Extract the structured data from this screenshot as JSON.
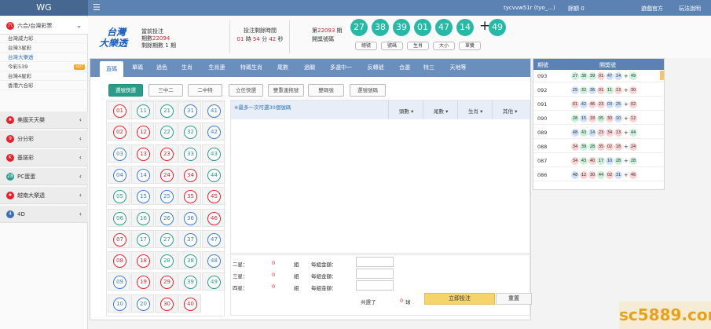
{
  "topbar": {
    "brand": "WG",
    "menu_icon": "hamburger-icon",
    "user": "tycvvw51r (tyo_...)",
    "balance_label": "餘額",
    "balance_value": "0",
    "link_agent": "遊戲官方",
    "link_rules": "玩法說明"
  },
  "sidebar": {
    "group_main": "六合/台灣彩票",
    "sub_items": [
      "台灣威力彩",
      "台灣3星彩",
      "台灣大樂透",
      "今彩539",
      "台灣4星彩",
      "香港六合彩"
    ],
    "hot_badge": "HOT",
    "groups": [
      {
        "label": "美國天天樂",
        "icon": "star-icon",
        "color": "#e5202a"
      },
      {
        "label": "分分彩",
        "icon": "nine-icon",
        "color": "#e5202a"
      },
      {
        "label": "基諾彩",
        "icon": "keno-icon",
        "color": "#e5202a"
      },
      {
        "label": "PC蛋蛋",
        "icon": "pc-icon",
        "color": "#2a9c88"
      },
      {
        "label": "越南大樂透",
        "icon": "star-icon",
        "color": "#e5202a"
      },
      {
        "label": "4D",
        "icon": "four-d-icon",
        "color": "#3a6fb5"
      }
    ]
  },
  "header": {
    "logo_line1": "台灣",
    "logo_line2": "大樂透",
    "info_label": "當前投注",
    "period_label": "期數",
    "period_value": "22094",
    "remaining_label": "剩餘期數",
    "remaining_value": "1",
    "remaining_unit": "期",
    "countdown_label": "投注剩餘時間",
    "cd_h": "01",
    "cd_h_unit": "時",
    "cd_m": "54",
    "cd_m_unit": "分",
    "cd_s": "42",
    "cd_s_unit": "秒",
    "last_prefix": "第",
    "last_period": "22093",
    "last_suffix": "期",
    "last_label": "開獎號碼",
    "balls": [
      "27",
      "38",
      "39",
      "01",
      "47",
      "14"
    ],
    "plus": "+",
    "special": "49",
    "stats": [
      "總號",
      "號碼",
      "生肖",
      "大小",
      "單雙"
    ]
  },
  "tabs": [
    "直碼",
    "單碼",
    "過色",
    "生肖",
    "生肖連",
    "特碼生肖",
    "尾數",
    "過關",
    "多選中一",
    "反轉號",
    "合選",
    "特三",
    "天地等"
  ],
  "sub_buttons": [
    "選號快選",
    "三中二",
    "二中特",
    "立任快選",
    "雙重連拖號",
    "雙碼號",
    "選號號碼"
  ],
  "numbers": [
    [
      "01",
      "11",
      "21",
      "31",
      "41"
    ],
    [
      "02",
      "12",
      "22",
      "32",
      "42"
    ],
    [
      "03",
      "13",
      "23",
      "33",
      "43"
    ],
    [
      "04",
      "14",
      "24",
      "34",
      "44"
    ],
    [
      "05",
      "15",
      "25",
      "35",
      "45"
    ],
    [
      "06",
      "16",
      "26",
      "36",
      "46"
    ],
    [
      "07",
      "17",
      "27",
      "37",
      "47"
    ],
    [
      "08",
      "18",
      "28",
      "38",
      "48"
    ],
    [
      "09",
      "19",
      "29",
      "39",
      "49"
    ],
    [
      "10",
      "20",
      "30",
      "40"
    ]
  ],
  "selection": {
    "note": "※最多一次可選30個號碼",
    "cols": [
      "頭數",
      "尾數",
      "生肖",
      "其他"
    ]
  },
  "summary": {
    "rows": [
      {
        "label": "二星：",
        "count": "0",
        "unit": "組",
        "amount_label": "每組金額："
      },
      {
        "label": "三星：",
        "count": "0",
        "unit": "組",
        "amount_label": "每組金額："
      },
      {
        "label": "四星：",
        "count": "0",
        "unit": "組",
        "amount_label": "每組金額："
      }
    ],
    "total_label": "共選了",
    "total_value": "0",
    "total_unit": "球",
    "submit": "立即投注",
    "reset": "重置"
  },
  "history": {
    "col_period": "期號",
    "col_numbers": "開獎號",
    "rows": [
      {
        "period": "093",
        "balls": [
          "27",
          "38",
          "39",
          "01",
          "47",
          "14"
        ],
        "special": "49"
      },
      {
        "period": "092",
        "balls": [
          "25",
          "32",
          "36",
          "01",
          "11",
          "13"
        ],
        "special": "30"
      },
      {
        "period": "091",
        "balls": [
          "01",
          "42",
          "46",
          "23",
          "03",
          "25"
        ],
        "special": "02"
      },
      {
        "period": "090",
        "balls": [
          "28",
          "15",
          "18",
          "05",
          "30",
          "10"
        ],
        "special": "12"
      },
      {
        "period": "089",
        "balls": [
          "48",
          "43",
          "14",
          "23",
          "34",
          "13"
        ],
        "special": "44"
      },
      {
        "period": "088",
        "balls": [
          "34",
          "39",
          "28",
          "35",
          "02",
          "18"
        ],
        "special": "24"
      },
      {
        "period": "087",
        "balls": [
          "34",
          "43",
          "40",
          "17",
          "10",
          "28"
        ],
        "special": "28"
      },
      {
        "period": "086",
        "balls": [
          "48",
          "12",
          "30",
          "44",
          "02",
          "31"
        ],
        "special": "46"
      }
    ]
  },
  "colors": {
    "red": "#e5202a",
    "green": "#2a9c88",
    "blue": "#3a7bd5",
    "accent": "#5b82b3",
    "ball": "#27b9a6"
  },
  "red_nums": [
    "01",
    "02",
    "07",
    "08",
    "12",
    "13",
    "18",
    "19",
    "23",
    "24",
    "29",
    "30",
    "34",
    "35",
    "40",
    "45",
    "46"
  ],
  "blue_nums": [
    "03",
    "04",
    "09",
    "10",
    "14",
    "15",
    "20",
    "25",
    "26",
    "31",
    "36",
    "37",
    "41",
    "42",
    "47",
    "48"
  ],
  "green_nums": [
    "05",
    "06",
    "11",
    "16",
    "17",
    "21",
    "22",
    "27",
    "28",
    "32",
    "33",
    "38",
    "39",
    "43",
    "44",
    "49"
  ],
  "watermark": "sc5889.com"
}
